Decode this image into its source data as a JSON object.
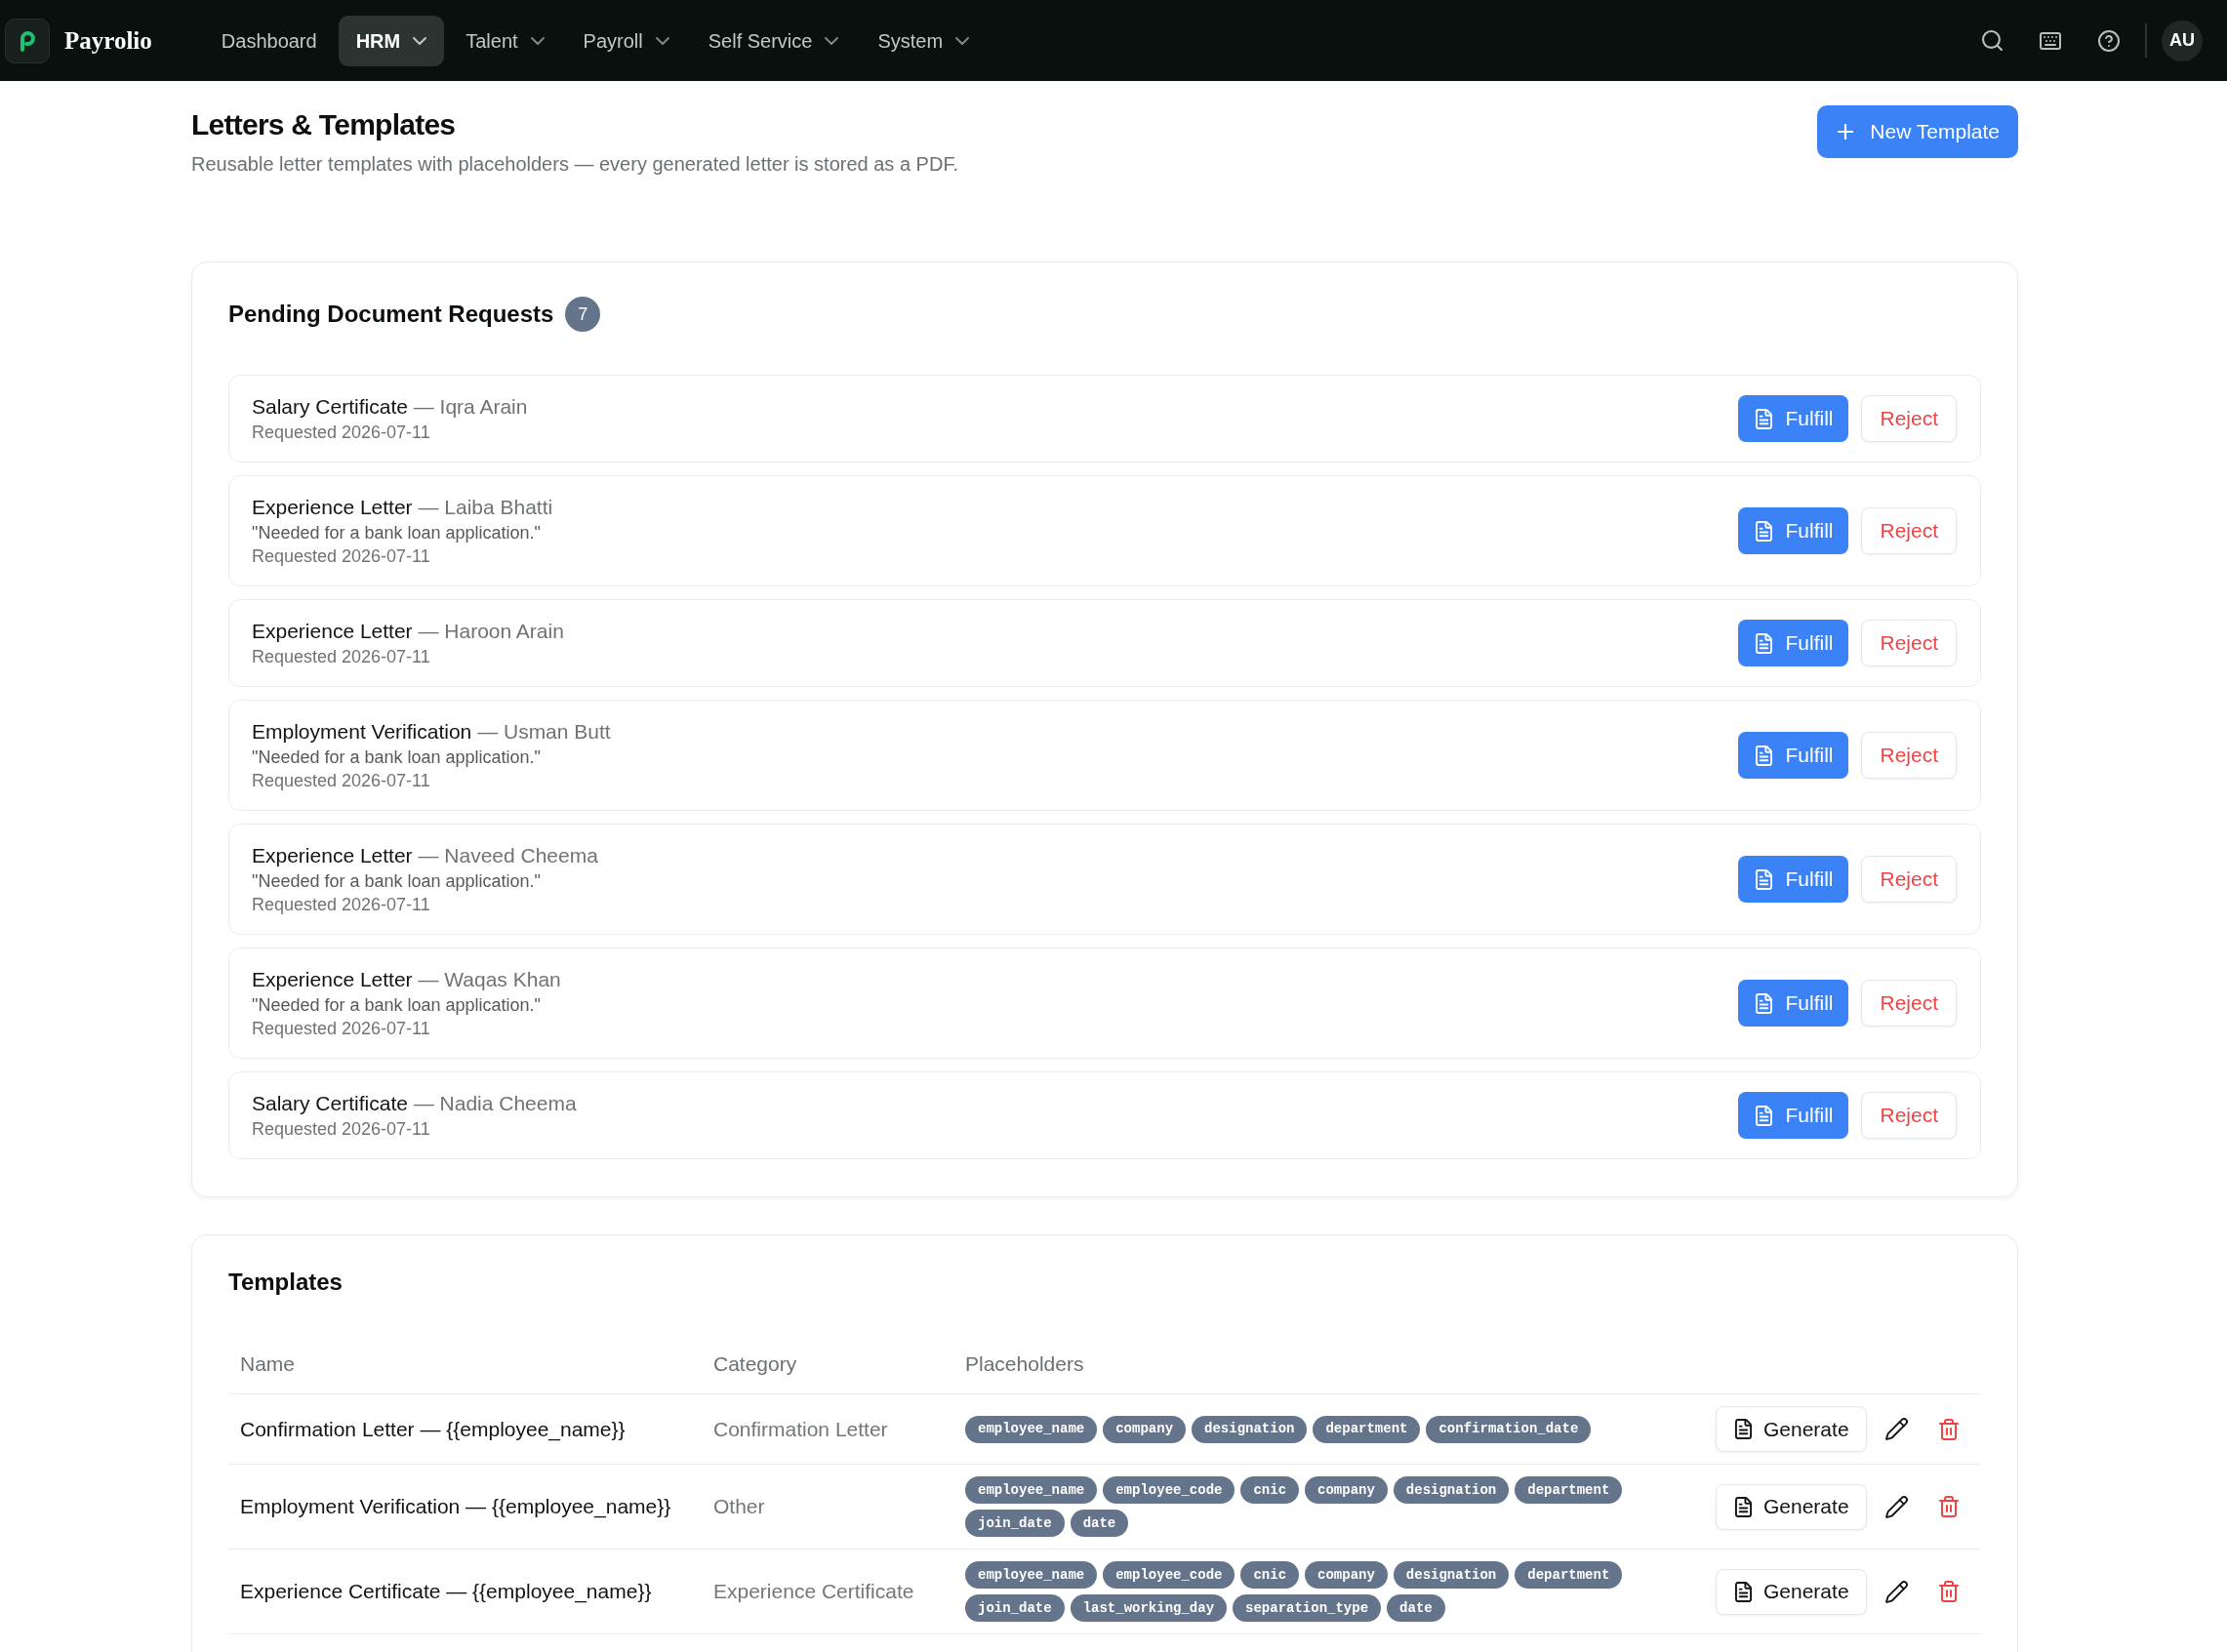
{
  "nav": {
    "brand": "Payrolio",
    "items": [
      {
        "label": "Dashboard",
        "selected": false,
        "has_dropdown": false
      },
      {
        "label": "HRM",
        "selected": true,
        "has_dropdown": true
      },
      {
        "label": "Talent",
        "selected": false,
        "has_dropdown": true
      },
      {
        "label": "Payroll",
        "selected": false,
        "has_dropdown": true
      },
      {
        "label": "Self Service",
        "selected": false,
        "has_dropdown": true
      },
      {
        "label": "System",
        "selected": false,
        "has_dropdown": true
      }
    ],
    "avatar": "AU"
  },
  "header": {
    "title": "Letters & Templates",
    "subtitle": "Reusable letter templates with placeholders — every generated letter is stored as a PDF.",
    "new_button": "New Template"
  },
  "pending": {
    "title": "Pending Document Requests",
    "count": "7",
    "requests": [
      {
        "document": "Salary Certificate",
        "employee": "— Iqra Arain",
        "requested": "Requested 2026-07-11",
        "fulfill": "Fulfill",
        "reject": "Reject"
      },
      {
        "document": "Experience Letter",
        "employee": "— Laiba Bhatti",
        "note": "\"Needed for a bank loan application.\"",
        "requested": "Requested 2026-07-11",
        "fulfill": "Fulfill",
        "reject": "Reject"
      },
      {
        "document": "Experience Letter",
        "employee": "— Haroon Arain",
        "requested": "Requested 2026-07-11",
        "fulfill": "Fulfill",
        "reject": "Reject"
      },
      {
        "document": "Employment Verification",
        "employee": "— Usman Butt",
        "note": "\"Needed for a bank loan application.\"",
        "requested": "Requested 2026-07-11",
        "fulfill": "Fulfill",
        "reject": "Reject"
      },
      {
        "document": "Experience Letter",
        "employee": "— Naveed Cheema",
        "note": "\"Needed for a bank loan application.\"",
        "requested": "Requested 2026-07-11",
        "fulfill": "Fulfill",
        "reject": "Reject"
      },
      {
        "document": "Experience Letter",
        "employee": "— Waqas Khan",
        "note": "\"Needed for a bank loan application.\"",
        "requested": "Requested 2026-07-11",
        "fulfill": "Fulfill",
        "reject": "Reject"
      },
      {
        "document": "Salary Certificate",
        "employee": "— Nadia Cheema",
        "requested": "Requested 2026-07-11",
        "fulfill": "Fulfill",
        "reject": "Reject"
      }
    ]
  },
  "templates": {
    "title": "Templates",
    "columns": [
      "Name",
      "Category",
      "Placeholders"
    ],
    "rows": [
      {
        "name": "Confirmation Letter — {{employee_name}}",
        "category": "Confirmation Letter",
        "placeholders": [
          "employee_name",
          "company",
          "designation",
          "department",
          "confirmation_date"
        ],
        "action": "Generate"
      },
      {
        "name": "Employment Verification — {{employee_name}}",
        "category": "Other",
        "placeholders": [
          "employee_name",
          "employee_code",
          "cnic",
          "company",
          "designation",
          "department",
          "join_date",
          "date"
        ],
        "action": "Generate"
      },
      {
        "name": "Experience Certificate — {{employee_name}}",
        "category": "Experience Certificate",
        "placeholders": [
          "employee_name",
          "employee_code",
          "cnic",
          "company",
          "designation",
          "department",
          "join_date",
          "last_working_day",
          "separation_type",
          "date"
        ],
        "action": "Generate"
      }
    ]
  }
}
